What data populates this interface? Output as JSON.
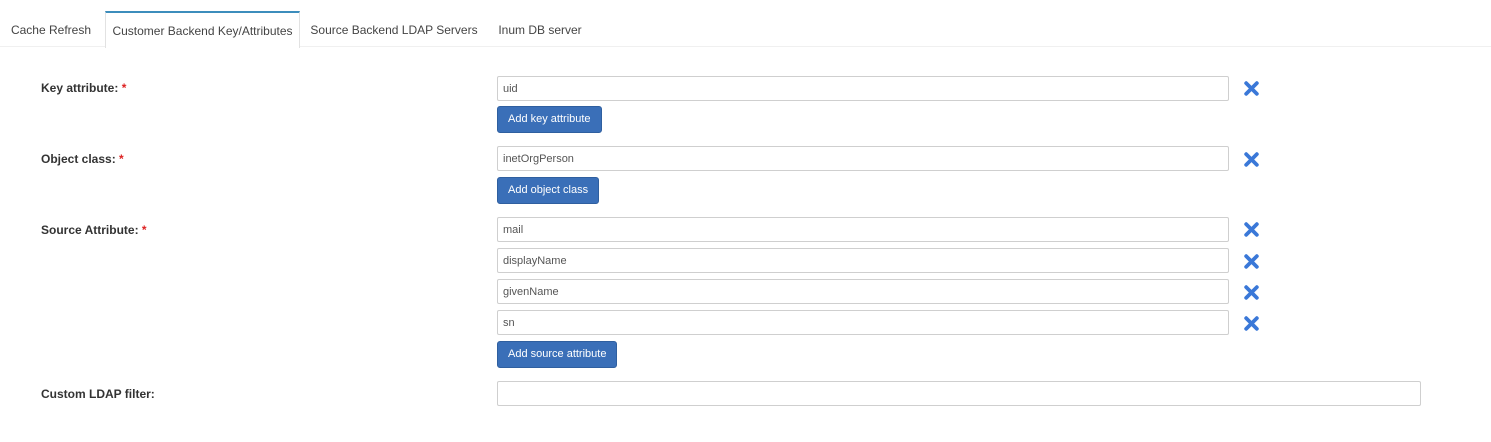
{
  "tabs": [
    {
      "label": "Cache Refresh",
      "active": false
    },
    {
      "label": "Customer Backend Key/Attributes",
      "active": true
    },
    {
      "label": "Source Backend LDAP Servers",
      "active": false
    },
    {
      "label": "Inum DB server",
      "active": false
    }
  ],
  "colors": {
    "accent": "#3c8dbc",
    "button": "#3a6fb8",
    "remove_icon": "#3a78d8",
    "required": "#dd2222"
  },
  "key_attribute": {
    "label": "Key attribute:",
    "required": "*",
    "values": [
      "uid"
    ],
    "add_button": "Add key attribute",
    "remove_icon": "close-icon"
  },
  "object_class": {
    "label": "Object class:",
    "required": "*",
    "values": [
      "inetOrgPerson"
    ],
    "add_button": "Add object class",
    "remove_icon": "close-icon"
  },
  "source_attribute": {
    "label": "Source Attribute:",
    "required": "*",
    "values": [
      "mail",
      "displayName",
      "givenName",
      "sn"
    ],
    "add_button": "Add source attribute",
    "remove_icon": "close-icon"
  },
  "custom_ldap_filter": {
    "label": "Custom LDAP filter:",
    "value": ""
  }
}
